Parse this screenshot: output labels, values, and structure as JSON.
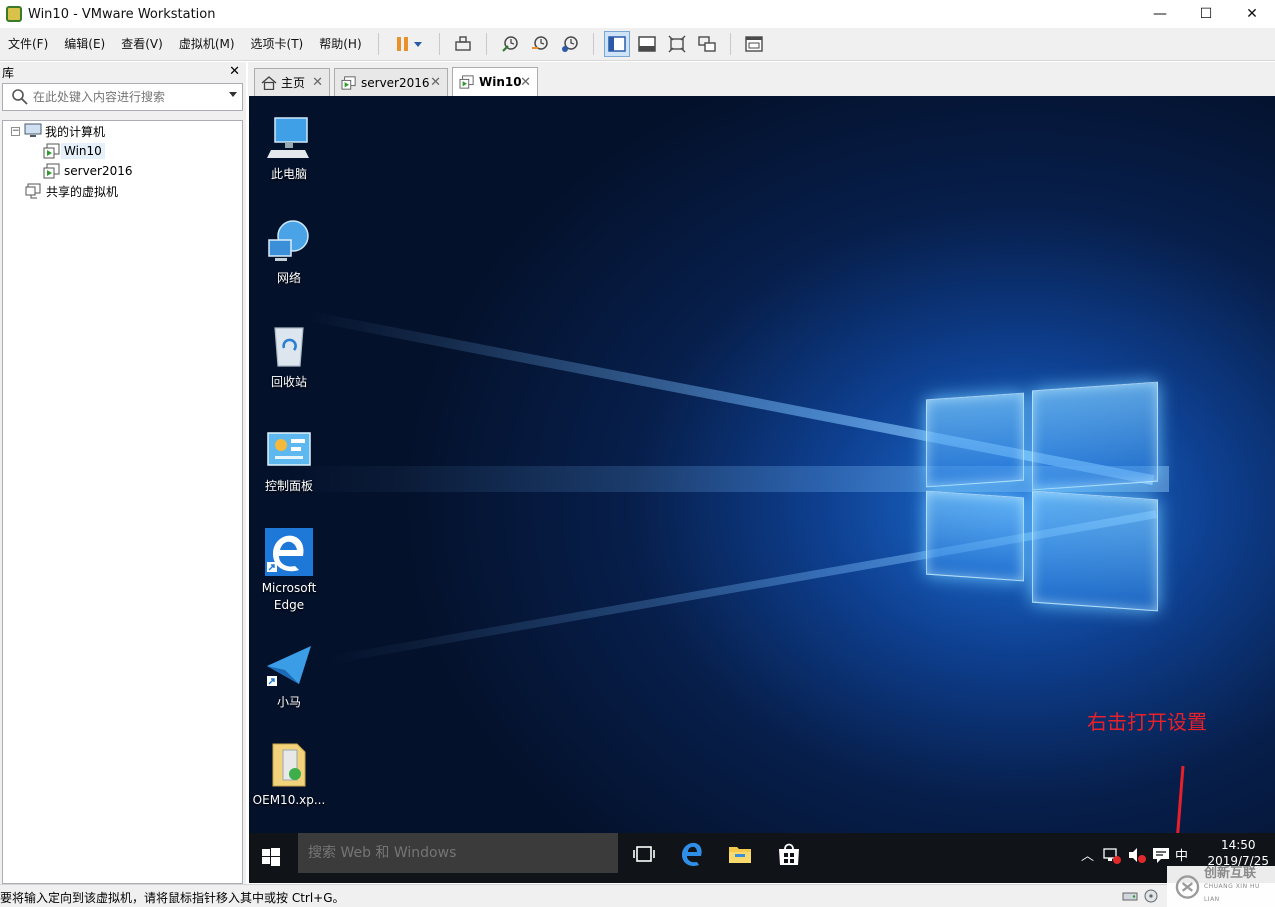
{
  "window": {
    "title": "Win10 - VMware Workstation",
    "minimize": "—",
    "maximize": "☐",
    "close": "✕"
  },
  "menu": [
    "文件(F)",
    "编辑(E)",
    "查看(V)",
    "虚拟机(M)",
    "选项卡(T)",
    "帮助(H)"
  ],
  "library": {
    "title": "库",
    "close": "✕",
    "search_placeholder": "在此处键入内容进行搜索",
    "tree": {
      "root": "我的计算机",
      "vms": [
        "Win10",
        "server2016"
      ],
      "shared": "共享的虚拟机",
      "selected": "Win10"
    }
  },
  "tabs": [
    {
      "label": "主页",
      "active": false
    },
    {
      "label": "server2016",
      "active": false
    },
    {
      "label": "Win10",
      "active": true
    }
  ],
  "desktop": {
    "icons": [
      "此电脑",
      "网络",
      "回收站",
      "控制面板",
      "Microsoft Edge",
      "小马",
      "OEM10.xp..."
    ],
    "annotation": "右击打开设置",
    "annotation_color": "#e8202a"
  },
  "taskbar": {
    "search_placeholder": "搜索 Web 和 Windows",
    "ime": "中",
    "time": "14:50",
    "date": "2019/7/25"
  },
  "statusbar": {
    "message": "要将输入定向到该虚拟机，请将鼠标指针移入其中或按 Ctrl+G。"
  },
  "watermark": {
    "text_cn": "创新互联",
    "text_en": "CHUANG XIN HU LIAN"
  },
  "colors": {
    "accent": "#1e78d8",
    "toolbar_pause": "#e8902a",
    "taskbar": "#101317"
  }
}
